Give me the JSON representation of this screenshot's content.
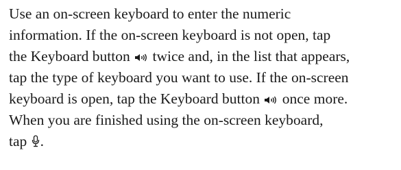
{
  "instructions": {
    "line1": "Use an on-screen keyboard to enter the numeric",
    "line2": "information. If the on-screen keyboard is not open, tap",
    "line3_before_icon": "the Keyboard button ",
    "line3_after_icon": " twice and, in the list that appears,",
    "line4": "tap the type of keyboard you want to use. If the on-screen",
    "line5_before_icon": "keyboard is open, tap the Keyboard button ",
    "line5_after_icon": " once more.",
    "line6": "When you are finished using the on-screen keyboard,",
    "line7_before_icon": "tap ",
    "line7_after_icon": "."
  },
  "icons": {
    "keyboard_button": "speaker-waves-icon",
    "microphone": "microphone-icon"
  }
}
